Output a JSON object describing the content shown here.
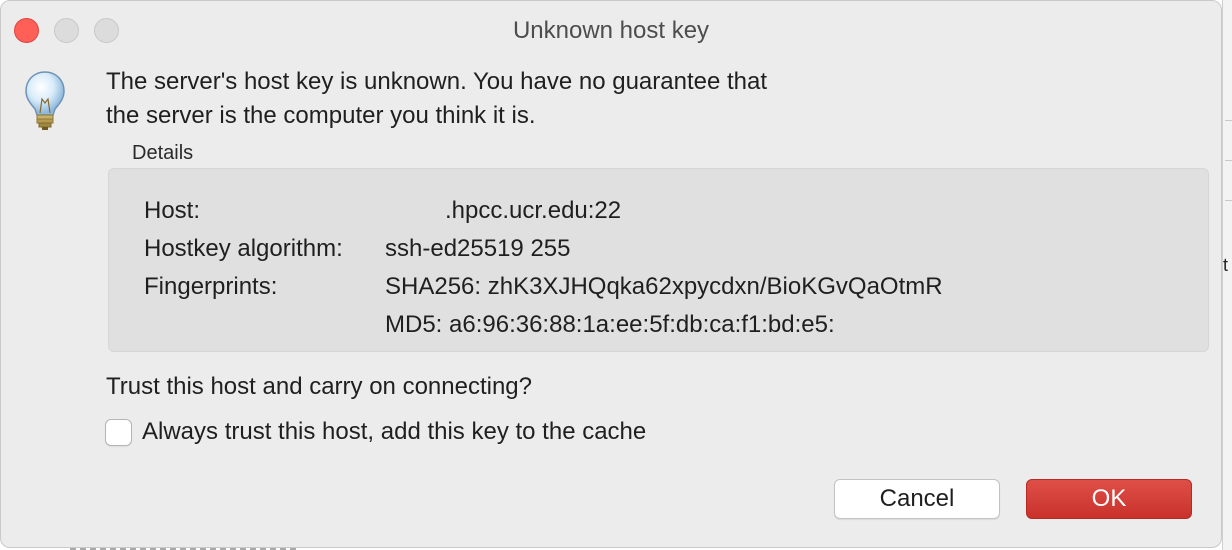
{
  "window": {
    "title": "Unknown host key"
  },
  "message": {
    "line1": "The server's host key is unknown. You have no guarantee that",
    "line2": "the server is the computer you think it is."
  },
  "details": {
    "label": "Details",
    "rows": [
      {
        "key": "Host:",
        "value": ".hpcc.ucr.edu:22"
      },
      {
        "key": "Hostkey algorithm:",
        "value": "ssh-ed25519 255"
      },
      {
        "key": "Fingerprints:",
        "value": "SHA256: zhK3XJHQqka62xpycdxn/BioKGvQaOtmR"
      },
      {
        "key": "",
        "value": "MD5: a6:96:36:88:1a:ee:5f:db:ca:f1:bd:e5:"
      }
    ]
  },
  "prompt": {
    "question": "Trust this host and carry on connecting?",
    "checkbox_label": "Always trust this host, add this key to the cache",
    "checkbox_checked": false
  },
  "buttons": {
    "cancel": "Cancel",
    "ok": "OK"
  },
  "colors": {
    "ok_button": "#d23d36",
    "close_button": "#fe5f57",
    "details_background": "#e0e0e0"
  },
  "icons": {
    "dialog_icon": "lightbulb-icon"
  }
}
